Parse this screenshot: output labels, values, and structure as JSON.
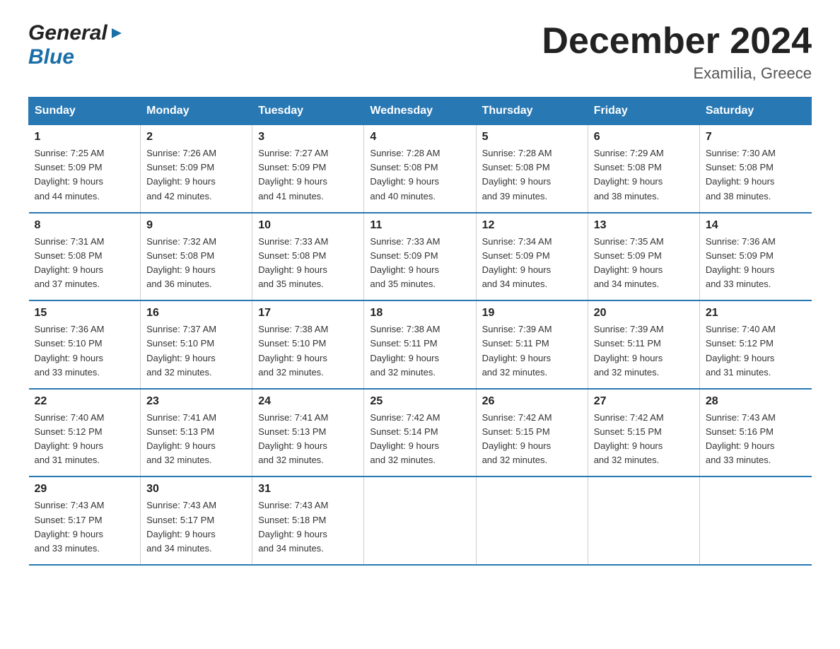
{
  "header": {
    "logo_general": "General",
    "logo_blue": "Blue",
    "month_title": "December 2024",
    "subtitle": "Examilia, Greece"
  },
  "days_of_week": [
    "Sunday",
    "Monday",
    "Tuesday",
    "Wednesday",
    "Thursday",
    "Friday",
    "Saturday"
  ],
  "weeks": [
    [
      {
        "day": "1",
        "sunrise": "7:25 AM",
        "sunset": "5:09 PM",
        "daylight": "9 hours and 44 minutes."
      },
      {
        "day": "2",
        "sunrise": "7:26 AM",
        "sunset": "5:09 PM",
        "daylight": "9 hours and 42 minutes."
      },
      {
        "day": "3",
        "sunrise": "7:27 AM",
        "sunset": "5:09 PM",
        "daylight": "9 hours and 41 minutes."
      },
      {
        "day": "4",
        "sunrise": "7:28 AM",
        "sunset": "5:08 PM",
        "daylight": "9 hours and 40 minutes."
      },
      {
        "day": "5",
        "sunrise": "7:28 AM",
        "sunset": "5:08 PM",
        "daylight": "9 hours and 39 minutes."
      },
      {
        "day": "6",
        "sunrise": "7:29 AM",
        "sunset": "5:08 PM",
        "daylight": "9 hours and 38 minutes."
      },
      {
        "day": "7",
        "sunrise": "7:30 AM",
        "sunset": "5:08 PM",
        "daylight": "9 hours and 38 minutes."
      }
    ],
    [
      {
        "day": "8",
        "sunrise": "7:31 AM",
        "sunset": "5:08 PM",
        "daylight": "9 hours and 37 minutes."
      },
      {
        "day": "9",
        "sunrise": "7:32 AM",
        "sunset": "5:08 PM",
        "daylight": "9 hours and 36 minutes."
      },
      {
        "day": "10",
        "sunrise": "7:33 AM",
        "sunset": "5:08 PM",
        "daylight": "9 hours and 35 minutes."
      },
      {
        "day": "11",
        "sunrise": "7:33 AM",
        "sunset": "5:09 PM",
        "daylight": "9 hours and 35 minutes."
      },
      {
        "day": "12",
        "sunrise": "7:34 AM",
        "sunset": "5:09 PM",
        "daylight": "9 hours and 34 minutes."
      },
      {
        "day": "13",
        "sunrise": "7:35 AM",
        "sunset": "5:09 PM",
        "daylight": "9 hours and 34 minutes."
      },
      {
        "day": "14",
        "sunrise": "7:36 AM",
        "sunset": "5:09 PM",
        "daylight": "9 hours and 33 minutes."
      }
    ],
    [
      {
        "day": "15",
        "sunrise": "7:36 AM",
        "sunset": "5:10 PM",
        "daylight": "9 hours and 33 minutes."
      },
      {
        "day": "16",
        "sunrise": "7:37 AM",
        "sunset": "5:10 PM",
        "daylight": "9 hours and 32 minutes."
      },
      {
        "day": "17",
        "sunrise": "7:38 AM",
        "sunset": "5:10 PM",
        "daylight": "9 hours and 32 minutes."
      },
      {
        "day": "18",
        "sunrise": "7:38 AM",
        "sunset": "5:11 PM",
        "daylight": "9 hours and 32 minutes."
      },
      {
        "day": "19",
        "sunrise": "7:39 AM",
        "sunset": "5:11 PM",
        "daylight": "9 hours and 32 minutes."
      },
      {
        "day": "20",
        "sunrise": "7:39 AM",
        "sunset": "5:11 PM",
        "daylight": "9 hours and 32 minutes."
      },
      {
        "day": "21",
        "sunrise": "7:40 AM",
        "sunset": "5:12 PM",
        "daylight": "9 hours and 31 minutes."
      }
    ],
    [
      {
        "day": "22",
        "sunrise": "7:40 AM",
        "sunset": "5:12 PM",
        "daylight": "9 hours and 31 minutes."
      },
      {
        "day": "23",
        "sunrise": "7:41 AM",
        "sunset": "5:13 PM",
        "daylight": "9 hours and 32 minutes."
      },
      {
        "day": "24",
        "sunrise": "7:41 AM",
        "sunset": "5:13 PM",
        "daylight": "9 hours and 32 minutes."
      },
      {
        "day": "25",
        "sunrise": "7:42 AM",
        "sunset": "5:14 PM",
        "daylight": "9 hours and 32 minutes."
      },
      {
        "day": "26",
        "sunrise": "7:42 AM",
        "sunset": "5:15 PM",
        "daylight": "9 hours and 32 minutes."
      },
      {
        "day": "27",
        "sunrise": "7:42 AM",
        "sunset": "5:15 PM",
        "daylight": "9 hours and 32 minutes."
      },
      {
        "day": "28",
        "sunrise": "7:43 AM",
        "sunset": "5:16 PM",
        "daylight": "9 hours and 33 minutes."
      }
    ],
    [
      {
        "day": "29",
        "sunrise": "7:43 AM",
        "sunset": "5:17 PM",
        "daylight": "9 hours and 33 minutes."
      },
      {
        "day": "30",
        "sunrise": "7:43 AM",
        "sunset": "5:17 PM",
        "daylight": "9 hours and 34 minutes."
      },
      {
        "day": "31",
        "sunrise": "7:43 AM",
        "sunset": "5:18 PM",
        "daylight": "9 hours and 34 minutes."
      },
      null,
      null,
      null,
      null
    ]
  ],
  "labels": {
    "sunrise": "Sunrise:",
    "sunset": "Sunset:",
    "daylight": "Daylight:"
  }
}
